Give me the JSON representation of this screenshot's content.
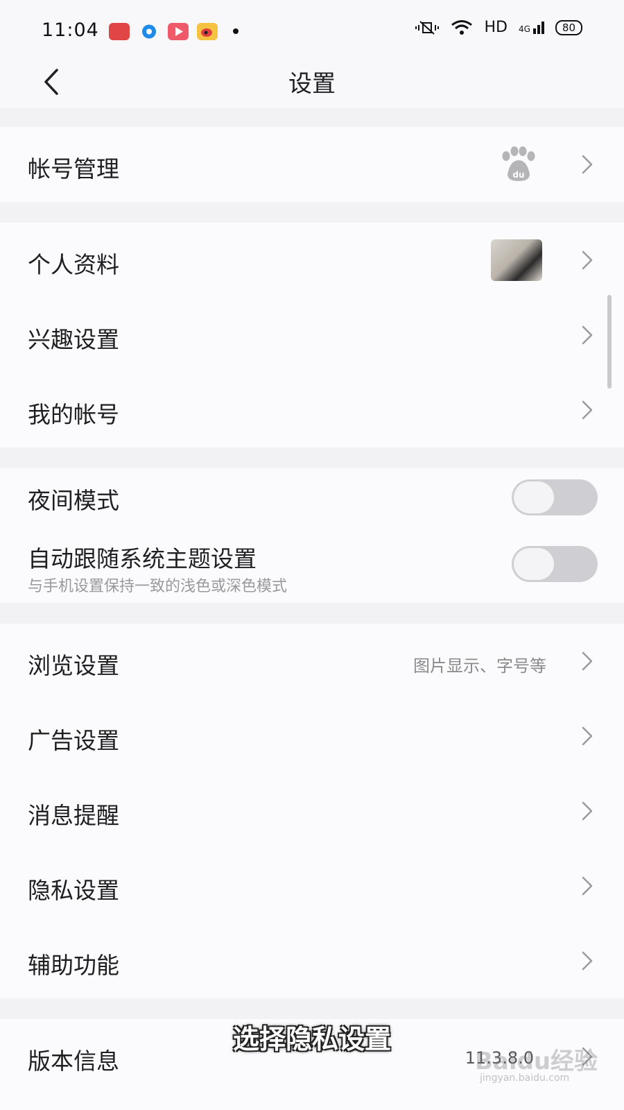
{
  "status_bar": {
    "time": "11:04",
    "network": "HD",
    "signal": "4G",
    "battery": "80"
  },
  "header": {
    "title": "设置"
  },
  "sections": {
    "account": {
      "label": "帐号管理"
    },
    "profile": {
      "label": "个人资料"
    },
    "interest": {
      "label": "兴趣设置"
    },
    "my_account": {
      "label": "我的帐号"
    },
    "night_mode": {
      "label": "夜间模式",
      "enabled": false
    },
    "auto_theme": {
      "label": "自动跟随系统主题设置",
      "subtitle": "与手机设置保持一致的浅色或深色模式",
      "enabled": false
    },
    "browse": {
      "label": "浏览设置",
      "value": "图片显示、字号等"
    },
    "ads": {
      "label": "广告设置"
    },
    "notifications": {
      "label": "消息提醒"
    },
    "privacy": {
      "label": "隐私设置"
    },
    "accessibility": {
      "label": "辅助功能"
    },
    "version": {
      "label": "版本信息",
      "value": "11.3.8.0"
    }
  },
  "overlay": {
    "caption": "选择隐私设置",
    "watermark": "Baidu经验",
    "watermark_url": "jingyan.baidu.com"
  },
  "colors": {
    "background": "#f2f2f4",
    "card": "#fbfbfd",
    "toggle_off": "#cfcfd3",
    "text": "#1f1f1f",
    "secondary": "#8a8a8a"
  }
}
